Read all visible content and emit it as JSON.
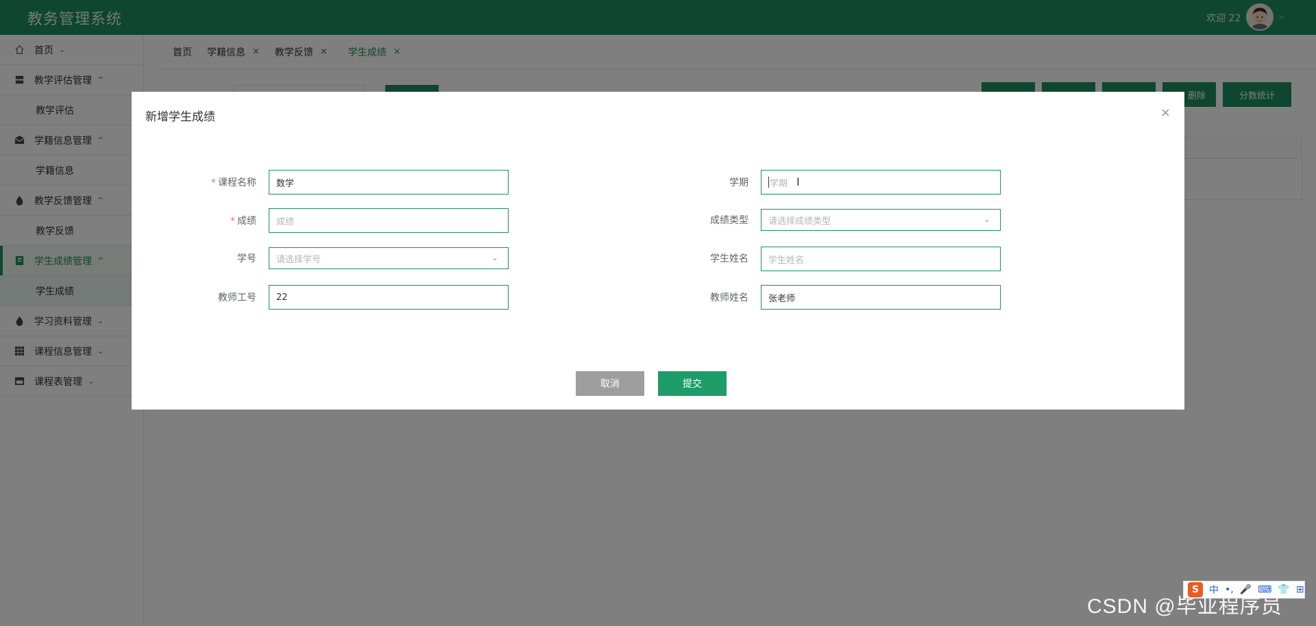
{
  "header": {
    "app_title": "教务管理系统",
    "welcome": "欢迎 22",
    "user_caret": "⌵"
  },
  "sidebar": {
    "items": [
      {
        "label": "首页",
        "caret": "⌄",
        "icon": "home-icon"
      },
      {
        "label": "教学评估管理",
        "caret": "^",
        "icon": "archive-icon",
        "children": [
          "教学评估"
        ]
      },
      {
        "label": "学籍信息管理",
        "caret": "^",
        "icon": "envelope-icon",
        "children": [
          "学籍信息"
        ]
      },
      {
        "label": "教学反馈管理",
        "caret": "^",
        "icon": "drop-icon",
        "children": [
          "教学反馈"
        ]
      },
      {
        "label": "学生成绩管理",
        "caret": "^",
        "icon": "book-icon",
        "children": [
          "学生成绩"
        ],
        "active": true
      },
      {
        "label": "学习资料管理",
        "caret": "⌄",
        "icon": "drop-icon"
      },
      {
        "label": "课程信息管理",
        "caret": "⌄",
        "icon": "grid-icon"
      },
      {
        "label": "课程表管理",
        "caret": "⌄",
        "icon": "store-icon"
      }
    ]
  },
  "tabs": [
    {
      "label": "首页",
      "closable": false
    },
    {
      "label": "学籍信息",
      "closable": true
    },
    {
      "label": "教学反馈",
      "closable": true
    },
    {
      "label": "学生成绩",
      "closable": true,
      "active": true
    }
  ],
  "tab_close_glyph": "×",
  "background": {
    "btn_delete_fragment": "删除",
    "btn_stats": "分数统计"
  },
  "modal": {
    "title": "新增学生成绩",
    "close": "×",
    "required_mark": "*",
    "fields": {
      "course_name": {
        "label": "课程名称",
        "value": "数学",
        "required": true
      },
      "semester": {
        "label": "学期",
        "placeholder": "学期"
      },
      "score": {
        "label": "成绩",
        "placeholder": "成绩",
        "required": true
      },
      "score_type": {
        "label": "成绩类型",
        "placeholder": "请选择成绩类型"
      },
      "student_id": {
        "label": "学号",
        "placeholder": "请选择学号"
      },
      "student_name": {
        "label": "学生姓名",
        "placeholder": "学生姓名"
      },
      "teacher_id": {
        "label": "教师工号",
        "value": "22"
      },
      "teacher_name": {
        "label": "教师姓名",
        "value": "张老师"
      }
    },
    "cancel": "取消",
    "submit": "提交",
    "select_caret": "⌄"
  },
  "watermark": "CSDN @毕业程序员",
  "ime": {
    "logo": "S",
    "items": [
      "中",
      "•,",
      "🎤",
      "⌨",
      "👕",
      "⊞"
    ]
  },
  "colors": {
    "primary": "#1e8c5e",
    "submit": "#1e9c6a",
    "cancel": "#9e9e9e",
    "required": "#f56c6c"
  }
}
